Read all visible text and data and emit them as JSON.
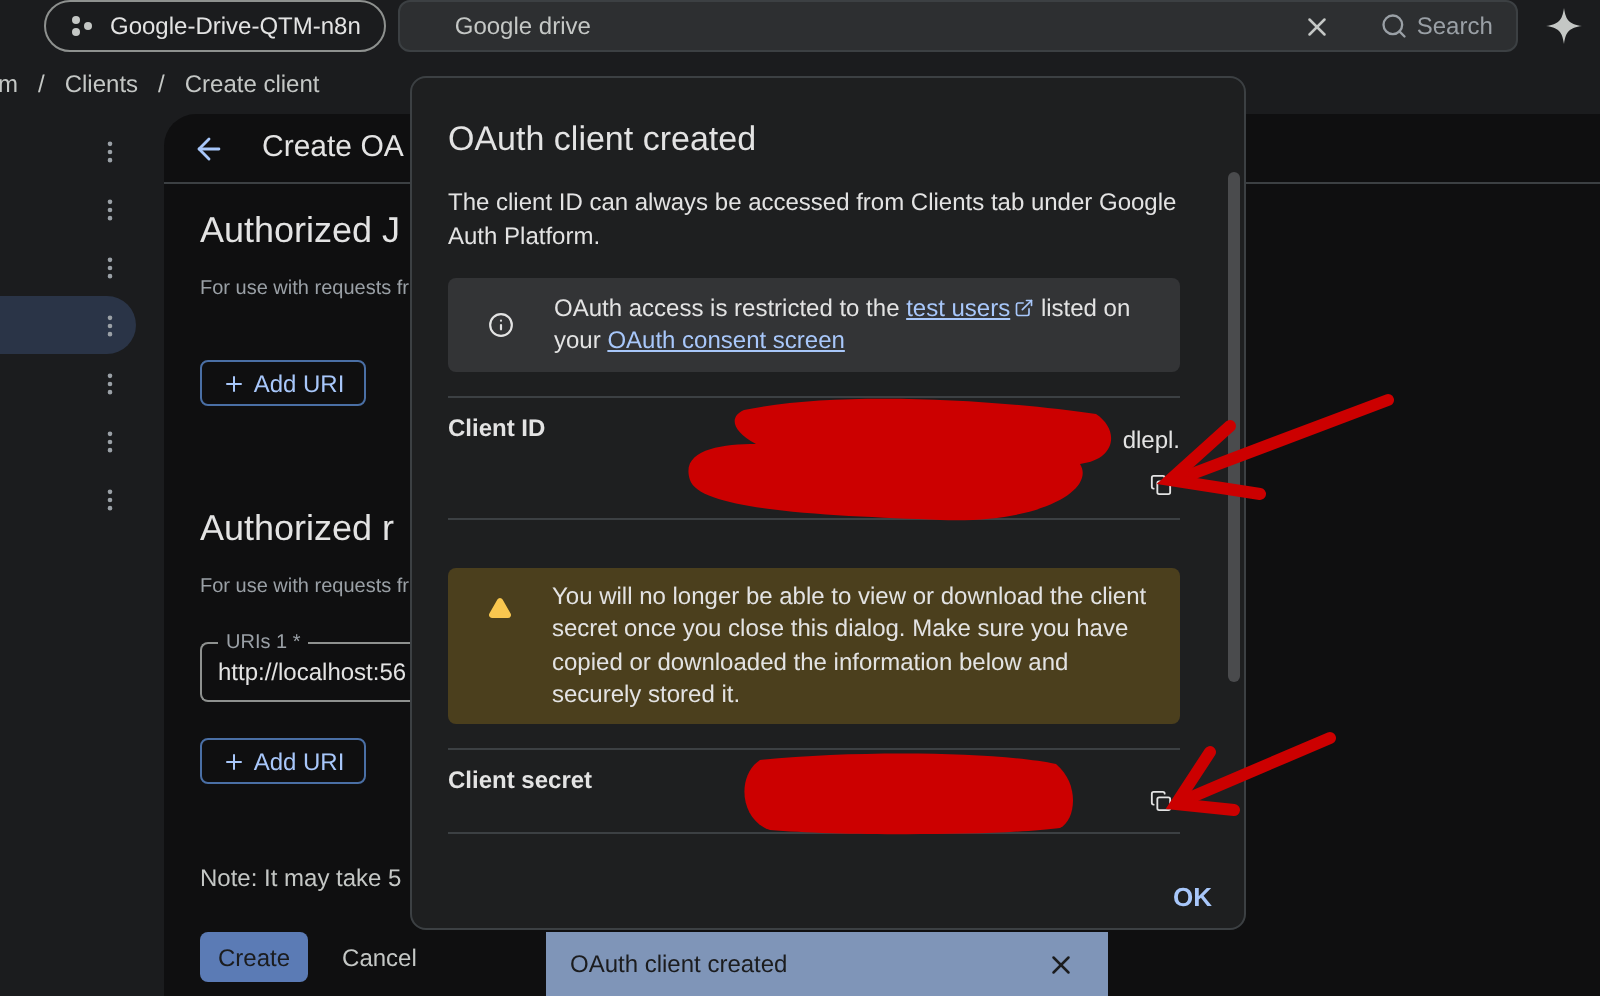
{
  "top_bar": {
    "project_chip": "Google-Drive-QTM-n8n",
    "search": {
      "value": "Google drive",
      "button": "Search"
    }
  },
  "breadcrumb": {
    "separator": "/",
    "items": [
      "m",
      "Clients",
      "Create client"
    ]
  },
  "sidebar": {
    "items": [
      {
        "selected": false
      },
      {
        "selected": false
      },
      {
        "selected": false
      },
      {
        "selected": true
      },
      {
        "selected": false
      },
      {
        "selected": false
      },
      {
        "selected": false
      }
    ]
  },
  "page": {
    "title": "Create OA",
    "sections": [
      {
        "heading": "Authorized J",
        "hint": "For use with requests fr",
        "button": "Add URI"
      },
      {
        "heading": "Authorized r",
        "hint": "For use with requests fr",
        "field": {
          "label": "URIs 1 *",
          "value": "http://localhost:56"
        },
        "button": "Add URI"
      }
    ],
    "note": "Note: It may take 5",
    "buttons": [
      {
        "label": "Create",
        "kind": "primary"
      },
      {
        "label": "Cancel",
        "kind": "text"
      }
    ]
  },
  "dialog": {
    "title": "OAuth client created",
    "description": "The client ID can always be accessed from Clients tab under Google Auth Platform.",
    "info": {
      "before": "OAuth access is restricted to the ",
      "link_1": "test users",
      "middle": " listed on your ",
      "link_2": "OAuth consent screen"
    },
    "client_id": {
      "label": "Client ID",
      "value": "dlepl."
    },
    "warning": "You will no longer be able to view or download the client secret once you close this dialog. Make sure you have copied or downloaded the information below and securely stored it.",
    "client_secret": {
      "label": "Client secret"
    },
    "ok": "OK"
  },
  "snackbar": {
    "text": "OAuth client created"
  }
}
